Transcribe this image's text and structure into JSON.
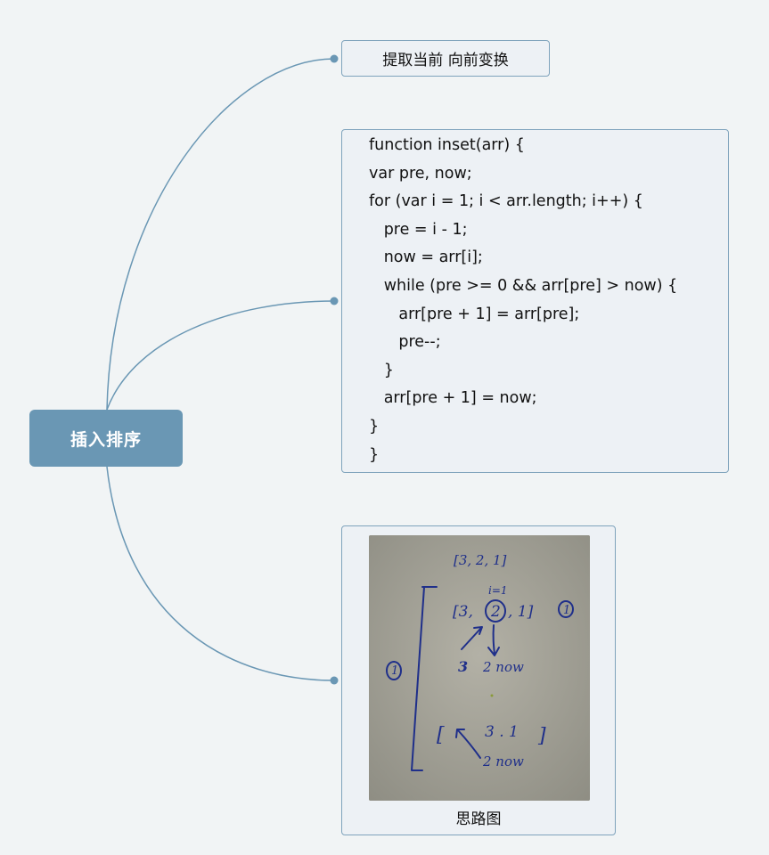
{
  "root": {
    "label": "插入排序"
  },
  "topic1": {
    "label": "提取当前 向前变换"
  },
  "topic2": {
    "lines": [
      "function inset(arr) {",
      "var pre, now;",
      "for (var i = 1; i < arr.length; i++) {",
      "   pre = i - 1;",
      "   now = arr[i];",
      "   while (pre >= 0 && arr[pre] > now) {",
      "      arr[pre + 1] = arr[pre];",
      "      pre--;",
      "   }",
      "   arr[pre + 1] = now;",
      "}",
      "}"
    ]
  },
  "topic3": {
    "caption": "思路图",
    "sketch": {
      "array": "[3, 2, 1]",
      "index": "i=1",
      "step1_left": "[3,",
      "step1_circled": "2",
      "step1_right": ", 1]",
      "mark": "1",
      "swap_left": "3",
      "swap_right": "2 now",
      "result_open": "[",
      "result_values": "3 . 1",
      "result_close": "]",
      "result_now": "2 now"
    }
  },
  "colors": {
    "root": "#6a97b4",
    "line": "#6a97b4",
    "topic_bg": "#edf1f5",
    "topic_border": "#7fa3bc",
    "ink": "#1f2f8a"
  }
}
